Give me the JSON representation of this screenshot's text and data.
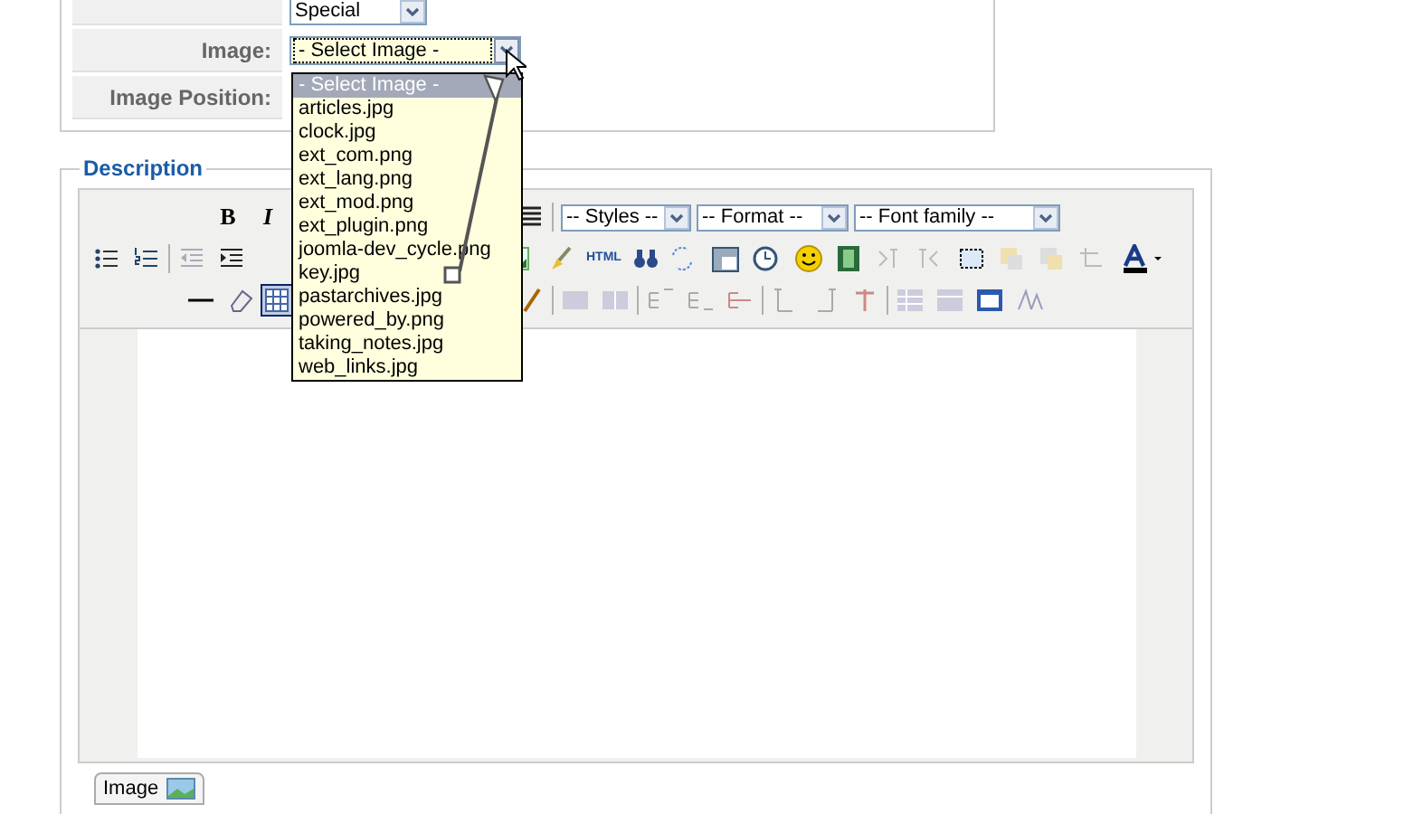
{
  "form": {
    "rows": [
      {
        "label": "",
        "value": "Special"
      },
      {
        "label": "Image:",
        "value": "- Select Image -"
      },
      {
        "label": "Image Position:",
        "value": ""
      }
    ]
  },
  "image_dropdown": {
    "open": true,
    "options": [
      {
        "label": "- Select Image -",
        "selected": true
      },
      {
        "label": "articles.jpg",
        "selected": false
      },
      {
        "label": "clock.jpg",
        "selected": false
      },
      {
        "label": "ext_com.png",
        "selected": false
      },
      {
        "label": "ext_lang.png",
        "selected": false
      },
      {
        "label": "ext_mod.png",
        "selected": false
      },
      {
        "label": "ext_plugin.png",
        "selected": false
      },
      {
        "label": "joomla-dev_cycle.png",
        "selected": false
      },
      {
        "label": "key.jpg",
        "selected": false
      },
      {
        "label": "pastarchives.jpg",
        "selected": false
      },
      {
        "label": "powered_by.png",
        "selected": false
      },
      {
        "label": "taking_notes.jpg",
        "selected": false
      },
      {
        "label": "web_links.jpg",
        "selected": false
      }
    ]
  },
  "description": {
    "legend": "Description",
    "toolbar": {
      "bold": "B",
      "italic": "I",
      "html_label": "HTML",
      "selects": [
        "-- Styles --",
        "-- Format --",
        "-- Font family --"
      ],
      "table_button": {
        "selected": true
      }
    },
    "image_button": "Image"
  }
}
